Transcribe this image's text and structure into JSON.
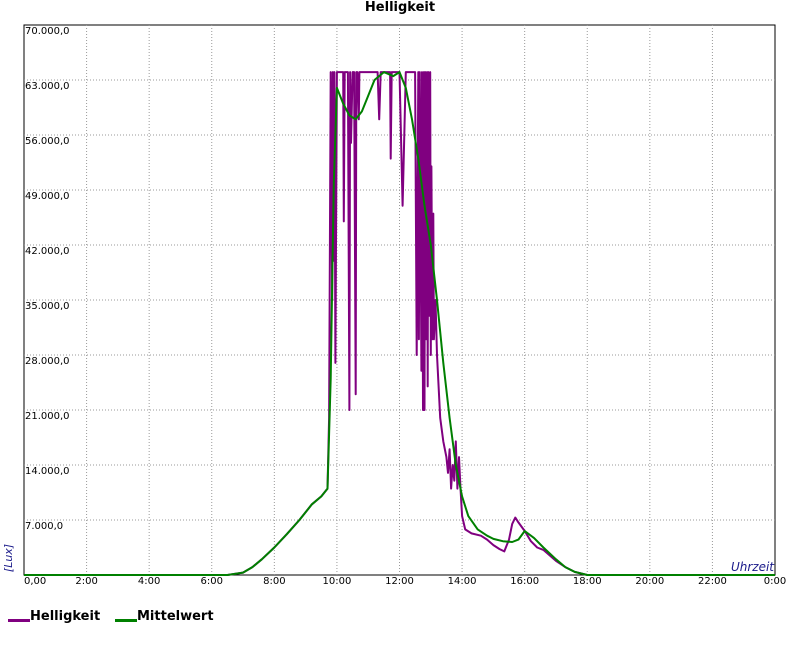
{
  "chart_data": {
    "type": "line",
    "title": "Helligkeit",
    "xlabel": "Uhrzeit",
    "ylabel": "[Lux]",
    "xlim": [
      0,
      24
    ],
    "ylim": [
      0,
      70000
    ],
    "grid": true,
    "x_ticks": [
      "0,00",
      "2:00",
      "4:00",
      "6:00",
      "8:00",
      "10:00",
      "12:00",
      "14:00",
      "16:00",
      "18:00",
      "20:00",
      "22:00",
      "0:00"
    ],
    "y_ticks": [
      "7.000,0",
      "14.000,0",
      "21.000,0",
      "28.000,0",
      "35.000,0",
      "42.000,0",
      "49.000,0",
      "56.000,0",
      "63.000,0",
      "70.000,0"
    ],
    "legend_position": "bottom-left",
    "series": [
      {
        "name": "Helligkeit",
        "color": "#800080",
        "x": [
          0,
          6.5,
          7.0,
          7.3,
          7.6,
          8.0,
          8.4,
          8.8,
          9.2,
          9.5,
          9.7,
          9.75,
          9.8,
          9.85,
          9.87,
          9.9,
          9.92,
          9.95,
          10.0,
          10.02,
          10.05,
          10.1,
          10.15,
          10.2,
          10.22,
          10.25,
          10.3,
          10.35,
          10.4,
          10.42,
          10.45,
          10.5,
          10.55,
          10.6,
          10.62,
          10.65,
          10.7,
          10.72,
          10.75,
          10.8,
          10.82,
          10.85,
          10.9,
          11.0,
          11.1,
          11.2,
          11.3,
          11.35,
          11.4,
          11.5,
          11.6,
          11.7,
          11.72,
          11.75,
          11.8,
          11.9,
          12.0,
          12.1,
          12.2,
          12.22,
          12.25,
          12.3,
          12.35,
          12.4,
          12.5,
          12.55,
          12.6,
          12.62,
          12.65,
          12.7,
          12.72,
          12.75,
          12.78,
          12.8,
          12.82,
          12.85,
          12.88,
          12.9,
          12.92,
          12.95,
          12.98,
          13.0,
          13.02,
          13.05,
          13.08,
          13.1,
          13.15,
          13.2,
          13.3,
          13.4,
          13.5,
          13.55,
          13.6,
          13.65,
          13.7,
          13.75,
          13.8,
          13.85,
          13.9,
          13.95,
          14.0,
          14.1,
          14.3,
          14.6,
          14.8,
          15.0,
          15.2,
          15.35,
          15.5,
          15.6,
          15.7,
          15.8,
          16.0,
          16.2,
          16.4,
          16.6,
          16.8,
          17.0,
          17.3,
          17.6,
          18.0,
          18.3,
          24.0
        ],
        "y": [
          0,
          0,
          300,
          1000,
          2000,
          3500,
          5200,
          7000,
          9000,
          10000,
          11000,
          20000,
          64000,
          35000,
          64000,
          40000,
          64000,
          27000,
          64000,
          64000,
          64000,
          64000,
          64000,
          64000,
          45000,
          64000,
          64000,
          64000,
          21000,
          64000,
          55000,
          64000,
          64000,
          23000,
          64000,
          64000,
          58000,
          64000,
          64000,
          64000,
          64000,
          64000,
          64000,
          64000,
          64000,
          64000,
          64000,
          58000,
          64000,
          64000,
          64000,
          64000,
          53000,
          64000,
          64000,
          64000,
          64000,
          47000,
          64000,
          64000,
          64000,
          64000,
          64000,
          64000,
          64000,
          28000,
          64000,
          30000,
          64000,
          26000,
          64000,
          21000,
          64000,
          21000,
          64000,
          30000,
          64000,
          24000,
          64000,
          33000,
          64000,
          28000,
          52000,
          30000,
          46000,
          30000,
          35000,
          28000,
          20000,
          17000,
          15000,
          13000,
          16000,
          11000,
          14000,
          12000,
          17000,
          11000,
          15000,
          11000,
          7500,
          5800,
          5300,
          5000,
          4500,
          3800,
          3300,
          3000,
          4500,
          6500,
          7300,
          6700,
          5600,
          4300,
          3500,
          3200,
          2500,
          1800,
          1000,
          400,
          0,
          0,
          0
        ]
      },
      {
        "name": "Mittelwert",
        "color": "#008000",
        "x": [
          0,
          6.5,
          7.0,
          7.3,
          7.6,
          8.0,
          8.4,
          8.8,
          9.2,
          9.5,
          9.7,
          9.8,
          9.9,
          10.0,
          10.2,
          10.4,
          10.6,
          10.8,
          11.0,
          11.2,
          11.5,
          11.8,
          12.0,
          12.2,
          12.4,
          12.6,
          12.8,
          13.0,
          13.2,
          13.4,
          13.6,
          13.8,
          14.0,
          14.2,
          14.5,
          14.8,
          15.0,
          15.3,
          15.6,
          15.8,
          16.0,
          16.3,
          16.6,
          17.0,
          17.3,
          17.6,
          18.0,
          18.3,
          24.0
        ],
        "y": [
          0,
          0,
          300,
          1000,
          2000,
          3500,
          5200,
          7000,
          9000,
          10000,
          11000,
          25000,
          50000,
          62000,
          60000,
          58500,
          58000,
          59000,
          61000,
          63000,
          64000,
          63500,
          64000,
          62000,
          58000,
          53000,
          47000,
          42000,
          35000,
          27000,
          20000,
          14000,
          10000,
          7500,
          5800,
          5000,
          4600,
          4300,
          4200,
          4500,
          5600,
          4700,
          3500,
          2000,
          1000,
          400,
          0,
          0,
          0
        ]
      }
    ]
  }
}
